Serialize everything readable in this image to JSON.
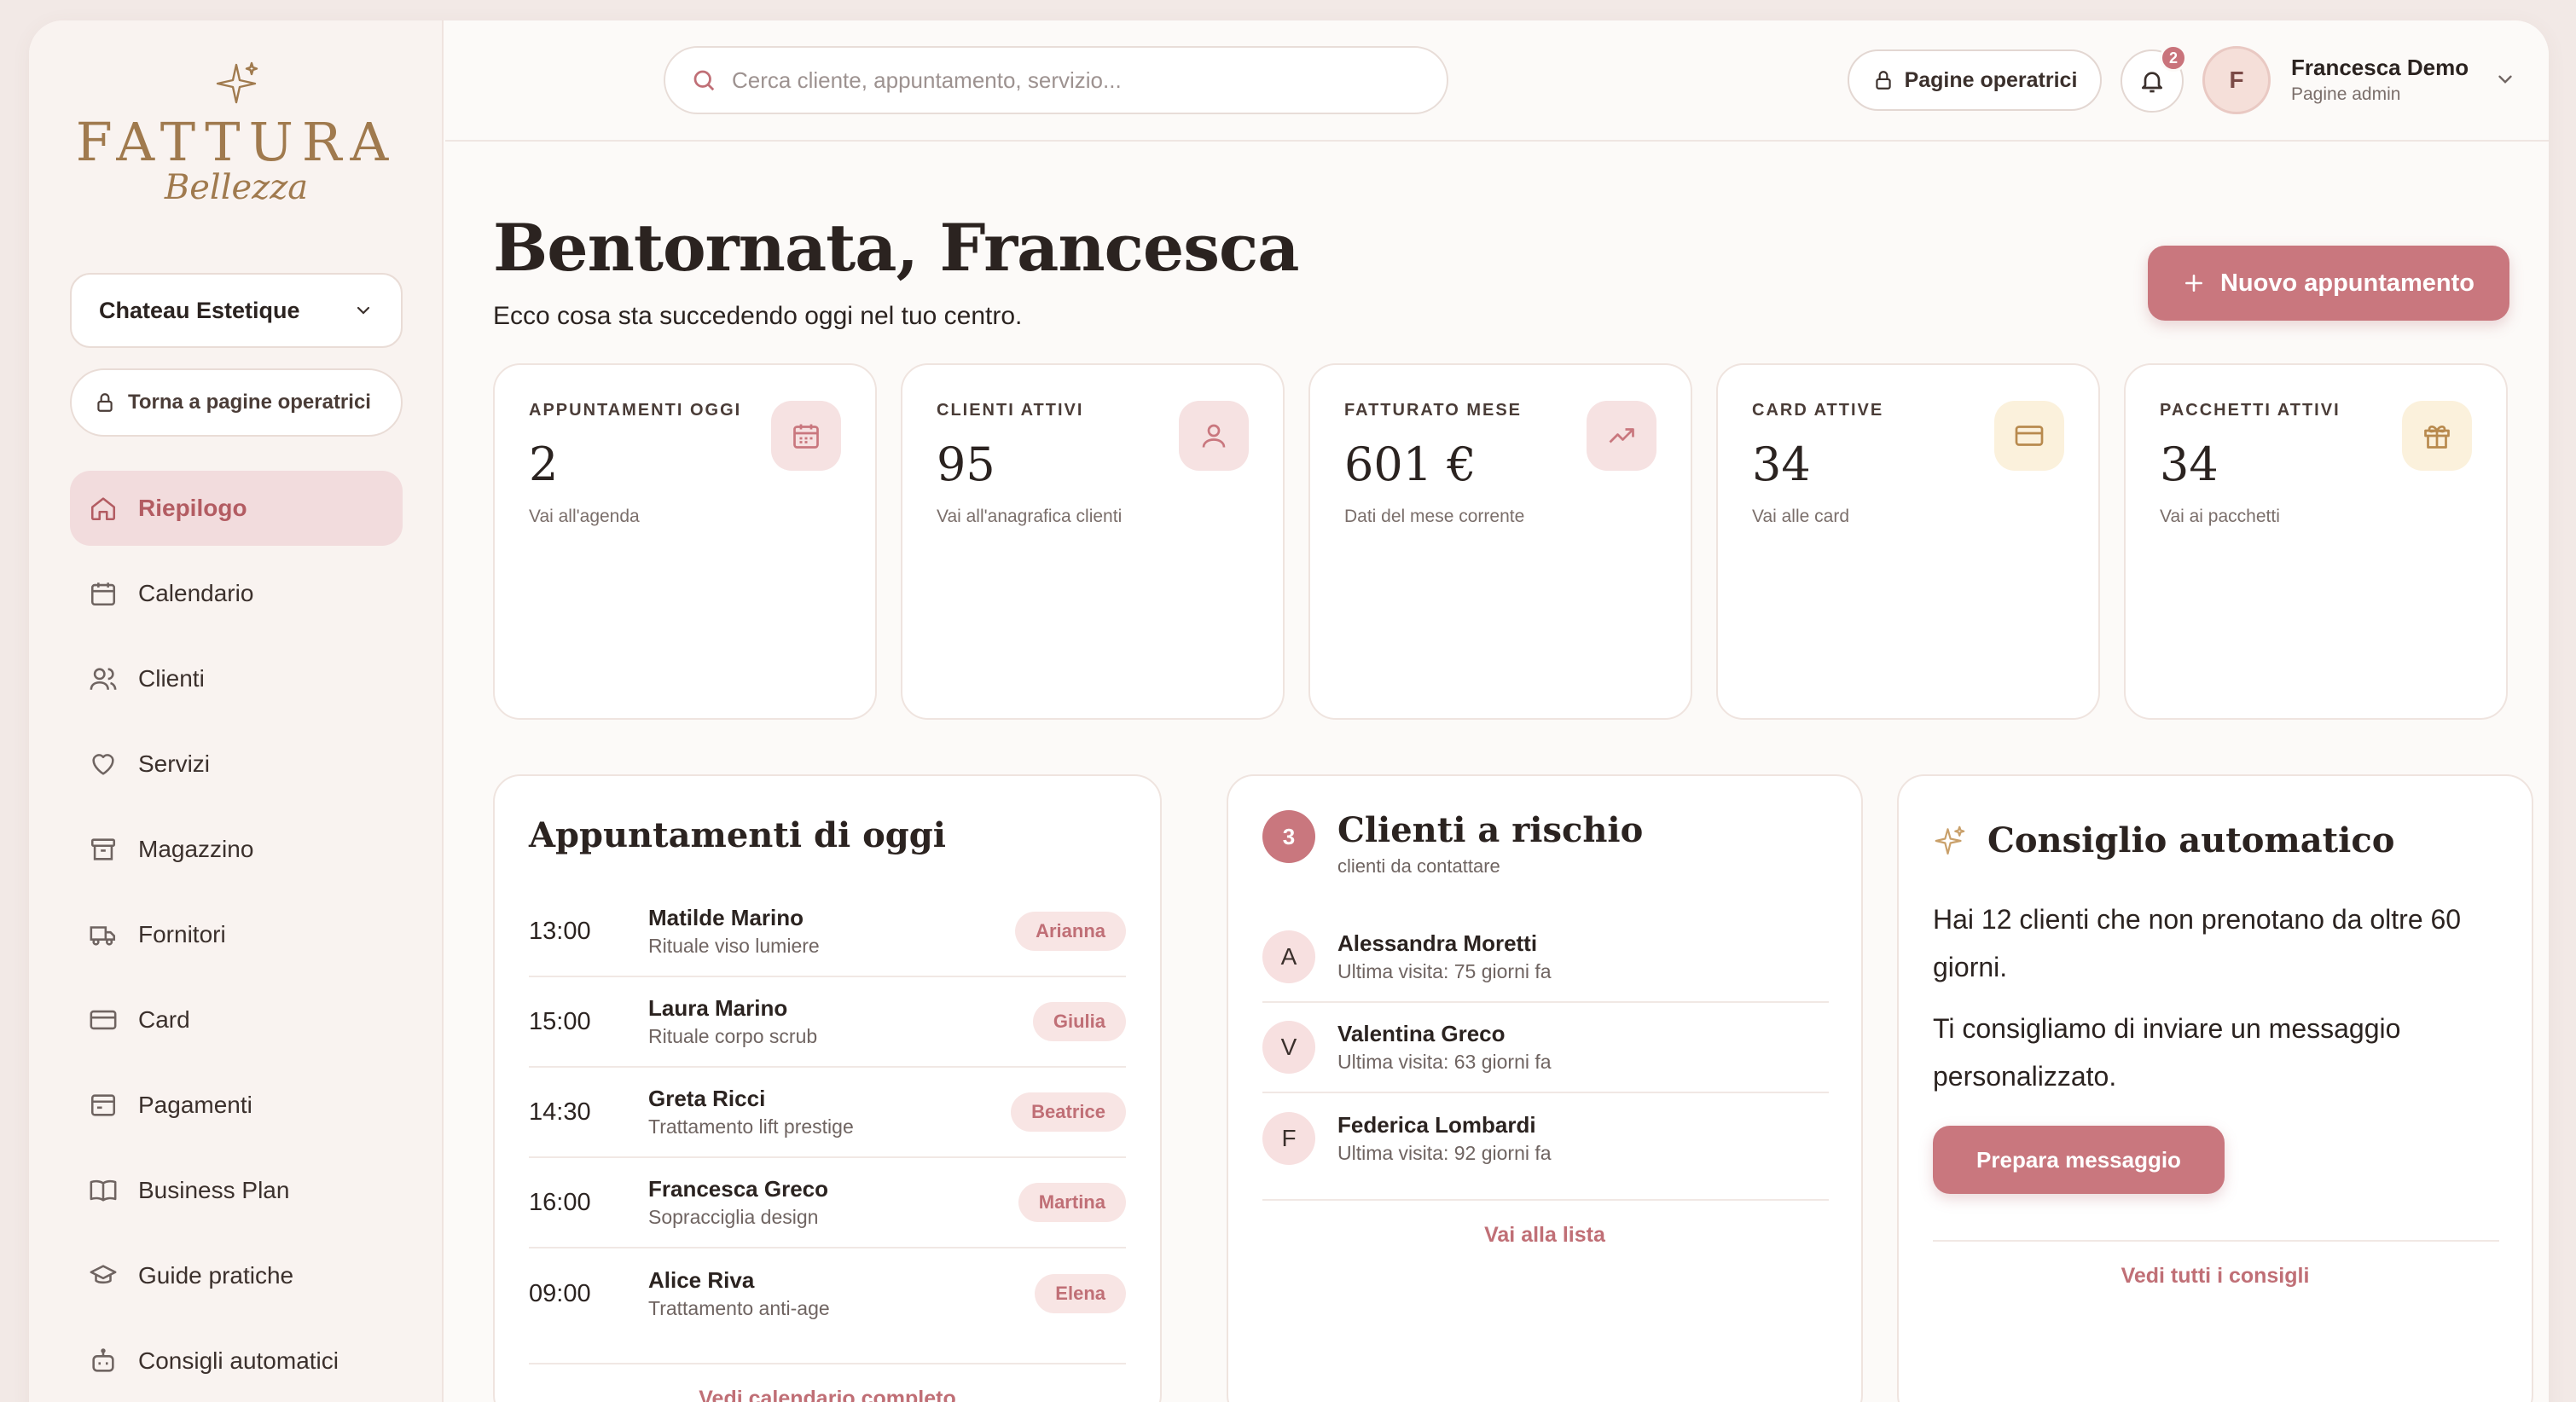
{
  "brand": {
    "name": "FATTURA",
    "sub": "Bellezza",
    "icon": "sparkle-icon"
  },
  "sidebar": {
    "center_select": "Chateau Estetique",
    "back_button": "Torna a pagine operatrici",
    "items": [
      {
        "label": "Riepilogo",
        "icon": "home-icon",
        "active": true
      },
      {
        "label": "Calendario",
        "icon": "calendar-icon"
      },
      {
        "label": "Clienti",
        "icon": "users-icon"
      },
      {
        "label": "Servizi",
        "icon": "heart-icon"
      },
      {
        "label": "Magazzino",
        "icon": "archive-icon"
      },
      {
        "label": "Fornitori",
        "icon": "truck-icon"
      },
      {
        "label": "Card",
        "icon": "credit-card-icon"
      },
      {
        "label": "Pagamenti",
        "icon": "wallet-icon"
      },
      {
        "label": "Business Plan",
        "icon": "book-icon"
      },
      {
        "label": "Guide pratiche",
        "icon": "graduation-cap-icon"
      },
      {
        "label": "Consigli automatici",
        "icon": "robot-icon"
      }
    ]
  },
  "topbar": {
    "search_placeholder": "Cerca cliente, appuntamento, servizio...",
    "operator_button": "Pagine operatrici",
    "notifications_count": "2",
    "user": {
      "initial": "F",
      "name": "Francesca Demo",
      "role": "Pagine admin"
    }
  },
  "main": {
    "greeting": "Bentornata, Francesca",
    "subtitle": "Ecco cosa sta succedendo oggi nel tuo centro.",
    "new_button": "Nuovo appuntamento",
    "stats": [
      {
        "label": "APPUNTAMENTI OGGI",
        "value": "2",
        "link": "Vai all'agenda",
        "icon": "calendar-icon"
      },
      {
        "label": "CLIENTI ATTIVI",
        "value": "95",
        "link": "Vai all'anagrafica clienti",
        "icon": "user-icon"
      },
      {
        "label": "FATTURATO MESE",
        "value": "601 €",
        "link": "Dati del mese corrente",
        "icon": "trending-up-icon"
      },
      {
        "label": "CARD ATTIVE",
        "value": "34",
        "link": "Vai alle card",
        "icon": "credit-card-icon"
      },
      {
        "label": "PACCHETTI ATTIVI",
        "value": "34",
        "link": "Vai ai pacchetti",
        "icon": "gift-icon"
      }
    ]
  },
  "appointments": {
    "title": "Appuntamenti di oggi",
    "items": [
      {
        "time": "13:00",
        "name": "Matilde Marino",
        "service": "Rituale viso lumiere",
        "staff": "Arianna"
      },
      {
        "time": "15:00",
        "name": "Laura Marino",
        "service": "Rituale corpo scrub",
        "staff": "Giulia"
      },
      {
        "time": "14:30",
        "name": "Greta Ricci",
        "service": "Trattamento lift prestige",
        "staff": "Beatrice"
      },
      {
        "time": "16:00",
        "name": "Francesca Greco",
        "service": "Sopracciglia design",
        "staff": "Martina"
      },
      {
        "time": "09:00",
        "name": "Alice Riva",
        "service": "Trattamento anti-age",
        "staff": "Elena"
      }
    ],
    "link": "Vedi calendario completo"
  },
  "risk": {
    "count": "3",
    "title": "Clienti a rischio",
    "subtitle": "clienti da contattare",
    "clients": [
      {
        "initial": "A",
        "name": "Alessandra Moretti",
        "meta": "Ultima visita: 75 giorni fa"
      },
      {
        "initial": "V",
        "name": "Valentina Greco",
        "meta": "Ultima visita: 63 giorni fa"
      },
      {
        "initial": "F",
        "name": "Federica Lombardi",
        "meta": "Ultima visita: 92 giorni fa"
      }
    ],
    "link": "Vai alla lista"
  },
  "tip": {
    "title": "Consiglio automatico",
    "text1": "Hai 12 clienti che non prenotano da oltre 60 giorni.",
    "text2": "Ti consigliamo di inviare un messaggio personalizzato.",
    "button": "Prepara messaggio",
    "link": "Vedi tutti i consigli"
  },
  "colors": {
    "accent": "#c9777e",
    "gold": "#a07a4e",
    "accent_soft": "#f6e2e2",
    "cream_soft": "#fbf1dc"
  }
}
